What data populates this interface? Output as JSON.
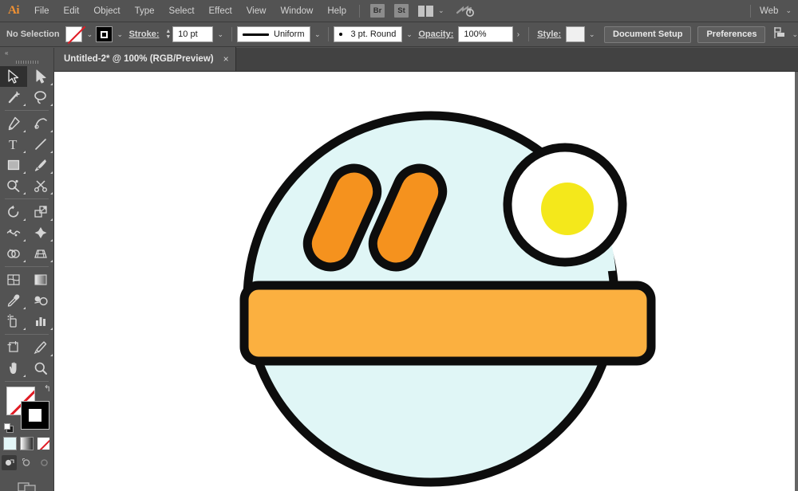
{
  "app": {
    "name": "Adobe Illustrator",
    "logo_text": "Ai"
  },
  "menubar": {
    "items": [
      {
        "label": "File"
      },
      {
        "label": "Edit"
      },
      {
        "label": "Object"
      },
      {
        "label": "Type"
      },
      {
        "label": "Select"
      },
      {
        "label": "Effect"
      },
      {
        "label": "View"
      },
      {
        "label": "Window"
      },
      {
        "label": "Help"
      }
    ],
    "bridge_label": "Br",
    "stock_label": "St",
    "arrange_caret": "⌄",
    "workspace_label": "Web",
    "workspace_caret": "⌄"
  },
  "controlbar": {
    "selection_status": "No Selection",
    "fill_label": "Fill",
    "fill_value": "None",
    "stroke_swatch_label": "Stroke color",
    "stroke_label": "Stroke:",
    "stroke_width_value": "10 pt",
    "stroke_profile_value": "Uniform",
    "stroke_cap_value": "3 pt. Round",
    "opacity_label": "Opacity:",
    "opacity_value": "100%",
    "opacity_more": "›",
    "style_label": "Style:",
    "document_setup_label": "Document Setup",
    "preferences_label": "Preferences",
    "caret": "⌄",
    "spinner_up": "▲",
    "spinner_down": "▼"
  },
  "tabbar": {
    "document_title": "Untitled-2* @ 100% (RGB/Preview)",
    "close_glyph": "×"
  },
  "toolbar": {
    "collapse_glyph": "«",
    "tools": [
      {
        "name": "selection-tool",
        "label": "Selection Tool",
        "active": true
      },
      {
        "name": "direct-selection-tool",
        "label": "Direct Selection Tool",
        "active": false
      },
      {
        "name": "magic-wand-tool",
        "label": "Magic Wand Tool",
        "active": false
      },
      {
        "name": "lasso-tool",
        "label": "Lasso Tool",
        "active": false
      },
      {
        "name": "pen-tool",
        "label": "Pen Tool",
        "active": false
      },
      {
        "name": "curvature-tool",
        "label": "Curvature Tool",
        "active": false
      },
      {
        "name": "type-tool",
        "label": "Type Tool",
        "active": false
      },
      {
        "name": "line-segment-tool",
        "label": "Line Segment Tool",
        "active": false
      },
      {
        "name": "rectangle-tool",
        "label": "Rectangle Tool",
        "active": false
      },
      {
        "name": "paintbrush-tool",
        "label": "Paintbrush Tool",
        "active": false
      },
      {
        "name": "shaper-tool",
        "label": "Shaper Tool",
        "active": false
      },
      {
        "name": "scissors-tool",
        "label": "Scissors Tool",
        "active": false
      },
      {
        "name": "rotate-tool",
        "label": "Rotate Tool",
        "active": false
      },
      {
        "name": "scale-tool",
        "label": "Scale Tool",
        "active": false
      },
      {
        "name": "width-tool",
        "label": "Width Tool",
        "active": false
      },
      {
        "name": "free-transform-tool",
        "label": "Free Transform Tool",
        "active": false
      },
      {
        "name": "shape-builder-tool",
        "label": "Shape Builder Tool",
        "active": false
      },
      {
        "name": "perspective-grid-tool",
        "label": "Perspective Grid Tool",
        "active": false
      },
      {
        "name": "mesh-tool",
        "label": "Mesh Tool",
        "active": false
      },
      {
        "name": "gradient-tool",
        "label": "Gradient Tool",
        "active": false
      },
      {
        "name": "eyedropper-tool",
        "label": "Eyedropper Tool",
        "active": false
      },
      {
        "name": "blend-tool",
        "label": "Blend Tool",
        "active": false
      },
      {
        "name": "symbol-sprayer-tool",
        "label": "Symbol Sprayer Tool",
        "active": false
      },
      {
        "name": "column-graph-tool",
        "label": "Column Graph Tool",
        "active": false
      },
      {
        "name": "artboard-tool",
        "label": "Artboard Tool",
        "active": false
      },
      {
        "name": "slice-tool",
        "label": "Slice Tool",
        "active": false
      },
      {
        "name": "hand-tool",
        "label": "Hand Tool",
        "active": false
      },
      {
        "name": "zoom-tool",
        "label": "Zoom Tool",
        "active": false
      }
    ],
    "fill_state": "None",
    "stroke_state": "Black",
    "swap_glyph": "↰",
    "paint_modes": [
      {
        "name": "color",
        "label": "Color"
      },
      {
        "name": "gradient",
        "label": "Gradient"
      },
      {
        "name": "none",
        "label": "None"
      }
    ],
    "draw_modes": [
      {
        "name": "draw-normal",
        "label": "Draw Normal",
        "selected": true
      },
      {
        "name": "draw-behind",
        "label": "Draw Behind",
        "selected": false
      },
      {
        "name": "draw-inside",
        "label": "Draw Inside",
        "selected": false
      }
    ],
    "screen_mode_label": "Change Screen Mode"
  },
  "artwork": {
    "title": "Breakfast plate icon",
    "colors": {
      "plate_fill": "#e0f6f6",
      "outline": "#0d0d0d",
      "sausage_fill": "#f5921e",
      "egg_white": "#ffffff",
      "egg_yolk": "#f4e81b",
      "toast_fill": "#fbb040",
      "canvas_bg": "#ffffff"
    },
    "elements": [
      {
        "name": "plate-circle",
        "fill": "#e0f6f6"
      },
      {
        "name": "sausage-left",
        "fill": "#f5921e"
      },
      {
        "name": "sausage-right",
        "fill": "#f5921e"
      },
      {
        "name": "fried-egg-white",
        "fill": "#ffffff"
      },
      {
        "name": "fried-egg-yolk",
        "fill": "#f4e81b"
      },
      {
        "name": "toast-bar",
        "fill": "#fbb040"
      }
    ]
  }
}
